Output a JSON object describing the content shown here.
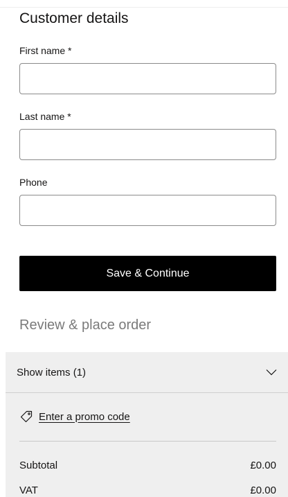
{
  "customer_details": {
    "title": "Customer details",
    "fields": [
      {
        "label": "First name *",
        "value": "",
        "placeholder": ""
      },
      {
        "label": "Last name *",
        "value": "",
        "placeholder": ""
      },
      {
        "label": "Phone",
        "value": "",
        "placeholder": ""
      }
    ],
    "submit_label": "Save & Continue"
  },
  "review": {
    "title": "Review & place order"
  },
  "summary": {
    "show_items_label": "Show items (1)",
    "toggle_icon": "chevron-down-icon",
    "promo_icon": "tag-icon",
    "promo_label": "Enter a promo code",
    "rows": [
      {
        "label": "Subtotal",
        "value": "£0.00"
      },
      {
        "label": "VAT",
        "value": "£0.00"
      }
    ]
  },
  "colors": {
    "button_background": "#000000",
    "button_text": "#ffffff",
    "panel_background": "#efefef",
    "muted_heading": "#7a7a7a",
    "input_border": "#8a8a8a"
  }
}
